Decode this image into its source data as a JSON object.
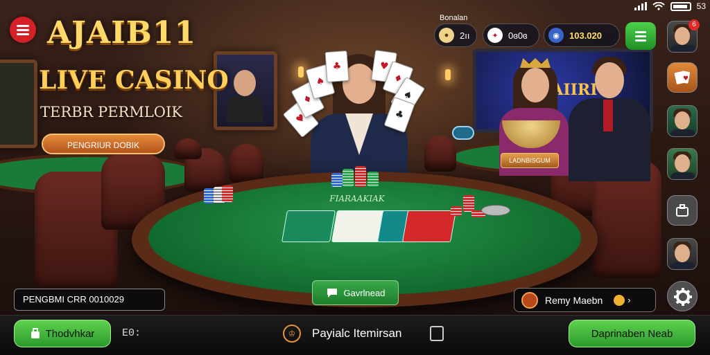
{
  "status_bar": {
    "label": "53"
  },
  "branding": {
    "title": "AJAIB11",
    "subtitle_main": "LIVE CASINO",
    "tagline": "TERBR PERMLOIK",
    "promo_button": "PENGRIUR DOBIK"
  },
  "top_bar": {
    "user_label": "Bonalan",
    "stat1_value": "2ıı",
    "stat2_value": "0ɞ0ɞ",
    "balance_value": "103.020",
    "notif_count": "6"
  },
  "table": {
    "felt_title": "FIARAAKIAK",
    "dealer_sign": "LADNBISGUM",
    "screen_text": "RAIIRIG"
  },
  "chat_button": "Gavrlnead",
  "id_box": "PENGBMI CRR 0010029",
  "player": {
    "name": "Remy Maebn"
  },
  "bottom_bar": {
    "left_button": "Thodvhkar",
    "counter": "E0:",
    "center_label": "Payialc Itemirsan",
    "right_button": "Daprinaben Neab"
  },
  "colors": {
    "accent_green": "#2a9a2c",
    "brand_gold": "#ffd86a",
    "danger_red": "#d62027",
    "felt": "#116a2f"
  }
}
